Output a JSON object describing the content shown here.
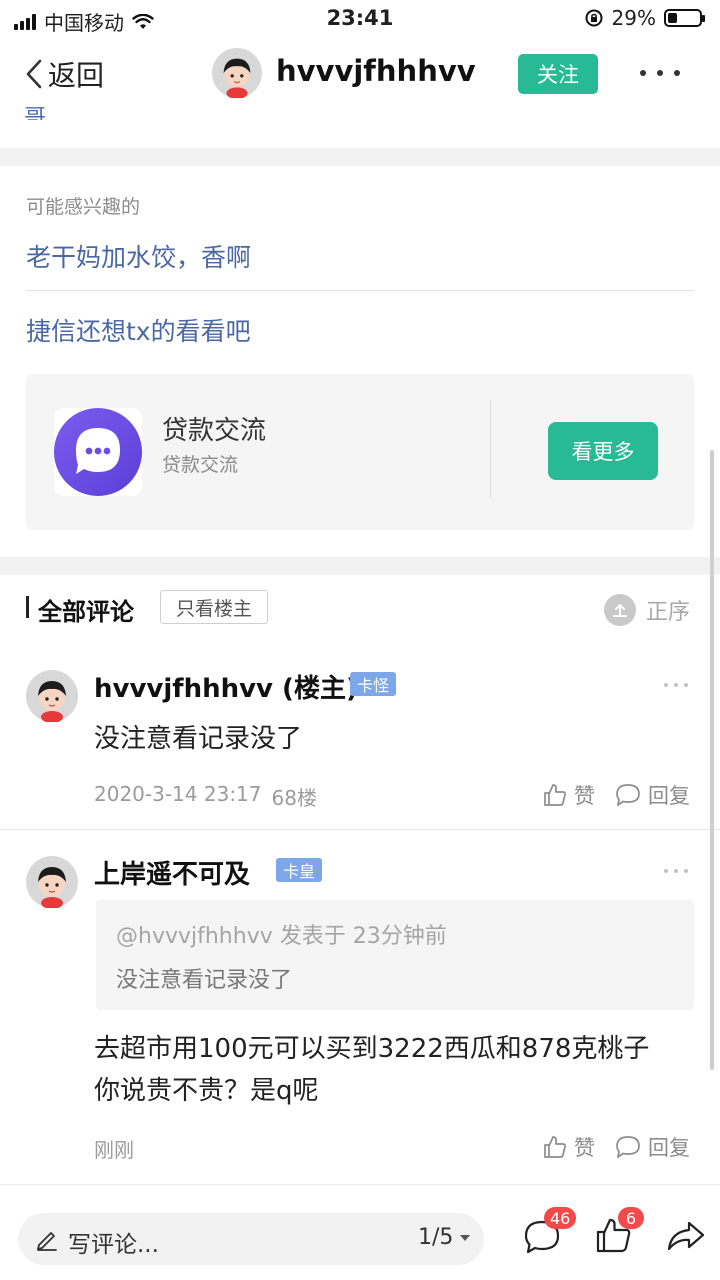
{
  "status_bar": {
    "carrier": "中国移动",
    "time": "23:41",
    "battery_text": "29%",
    "battery_level": 0.29
  },
  "nav": {
    "back_label": "返回",
    "username": "hvvvjfhhhvv",
    "follow_label": "关注"
  },
  "clipped_text": "哥",
  "interested": {
    "title": "可能感兴趣的",
    "links": [
      "老干妈加水饺，香啊",
      "捷信还想tx的看看吧"
    ]
  },
  "forum_card": {
    "name": "贷款交流",
    "subtitle": "贷款交流",
    "button": "看更多"
  },
  "comments_header": {
    "title": "全部评论",
    "filter": "只看楼主",
    "sort": "正序"
  },
  "comments": [
    {
      "user": "hvvvjfhhhvv (楼主)",
      "tag": "卡怪",
      "text": "没注意看记录没了",
      "time": "2020-3-14 23:17",
      "floor": "68楼",
      "like": "赞",
      "reply": "回复"
    },
    {
      "user": "上岸遥不可及",
      "tag": "卡皇",
      "quote_meta": "@hvvvjfhhhvv 发表于 23分钟前",
      "quote_text": "没注意看记录没了",
      "text_lines": [
        "去超市用100元可以买到3222西瓜和878克桃子",
        "你说贵不贵？是q呢"
      ],
      "time": "刚刚",
      "like": "赞",
      "reply": "回复"
    }
  ],
  "bottom_bar": {
    "input_placeholder": "写评论...",
    "page": "1/5",
    "comment_count": "46",
    "like_count": "6"
  },
  "colors": {
    "accent_green": "#28b995",
    "link_blue": "#4b68a4",
    "tag_blue": "#7da7e8",
    "badge_red": "#f24a4a"
  }
}
